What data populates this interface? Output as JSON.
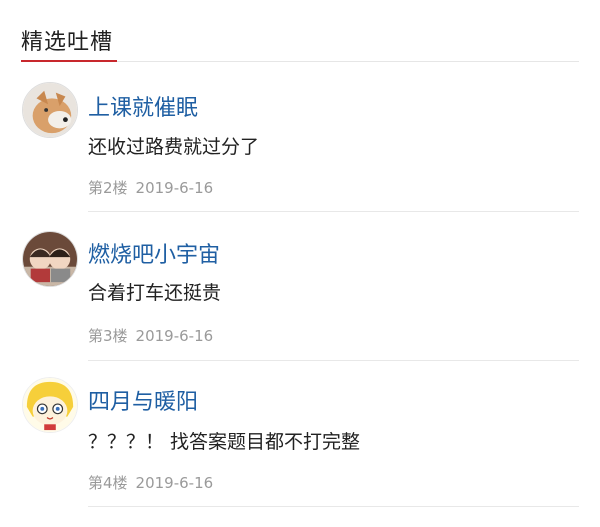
{
  "section": {
    "title": "精选吐槽"
  },
  "comments": [
    {
      "username": "上课就催眠",
      "text": "还收过路费就过分了",
      "floor": "第2楼",
      "date": "2019-6-16",
      "avatar_icon": "dog-avatar-icon"
    },
    {
      "username": "燃烧吧小宇宙",
      "text": "合着打车还挺贵",
      "floor": "第3楼",
      "date": "2019-6-16",
      "avatar_icon": "kids-photo-avatar-icon"
    },
    {
      "username": "四月与暖阳",
      "text": "？？？！ 找答案题目都不打完整",
      "floor": "第4楼",
      "date": "2019-6-16",
      "avatar_icon": "anime-girl-avatar-icon"
    }
  ],
  "colors": {
    "accent": "#c8282d",
    "username": "#1f5fa3",
    "meta": "#9a9a9a"
  }
}
